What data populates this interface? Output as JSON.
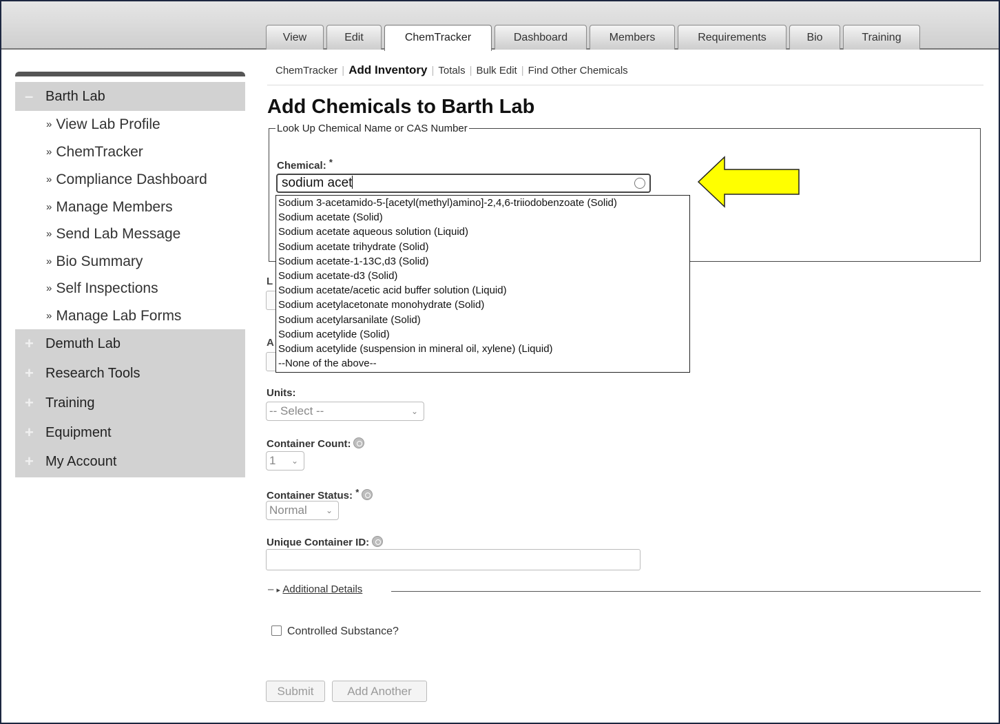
{
  "tabs": [
    "View",
    "Edit",
    "ChemTracker",
    "Dashboard",
    "Members",
    "Requirements",
    "Bio",
    "Training"
  ],
  "active_tab": "ChemTracker",
  "subnav": {
    "items": [
      "ChemTracker",
      "Add Inventory",
      "Totals",
      "Bulk Edit",
      "Find Other Chemicals"
    ],
    "active": "Add Inventory"
  },
  "sidebar": {
    "sections": [
      {
        "label": "Barth Lab",
        "toggle": "–",
        "expanded": true
      },
      {
        "label": "Demuth Lab",
        "toggle": "+"
      },
      {
        "label": "Research Tools",
        "toggle": "+"
      },
      {
        "label": "Training",
        "toggle": "+"
      },
      {
        "label": "Equipment",
        "toggle": "+"
      },
      {
        "label": "My Account",
        "toggle": "+"
      }
    ],
    "links_prefix": "»",
    "links": [
      "View Lab Profile",
      "ChemTracker",
      "Compliance Dashboard",
      "Manage Members",
      "Send Lab Message",
      "Bio Summary",
      "Self Inspections",
      "Manage Lab Forms"
    ]
  },
  "page_title": "Add Chemicals to Barth Lab",
  "lookup": {
    "legend": "Look Up Chemical Name or CAS Number",
    "chemical_label": "Chemical:",
    "required_mark": "*",
    "chemical_value": "sodium acet",
    "suggestions": [
      "Sodium 3-acetamido-5-[acetyl(methyl)amino]-2,4,6-triiodobenzoate (Solid)",
      "Sodium acetate (Solid)",
      "Sodium acetate aqueous solution (Liquid)",
      "Sodium acetate trihydrate (Solid)",
      "Sodium acetate-1-13C,d3 (Solid)",
      "Sodium acetate-d3 (Solid)",
      "Sodium acetate/acetic acid buffer solution (Liquid)",
      "Sodium acetylacetonate monohydrate (Solid)",
      "Sodium acetylarsanilate (Solid)",
      "Sodium acetylide (Solid)",
      "Sodium acetylide (suspension in mineral oil, xylene) (Liquid)",
      "--None of the above--"
    ]
  },
  "partial_labels": {
    "loc": "L",
    "amt": "A"
  },
  "form": {
    "units_label": "Units:",
    "units_value": "-- Select --",
    "count_label": "Container Count:",
    "count_value": "1",
    "status_label": "Container Status:",
    "status_value": "Normal",
    "uid_label": "Unique Container ID:",
    "uid_value": "",
    "details_toggle": "–",
    "details_arrow": "▸",
    "details_link": "Additional Details",
    "controlled_label": "Controlled Substance?",
    "controlled_checked": false
  },
  "buttons": {
    "submit": "Submit",
    "add_another": "Add Another"
  },
  "arrow_color": "#ffff00"
}
